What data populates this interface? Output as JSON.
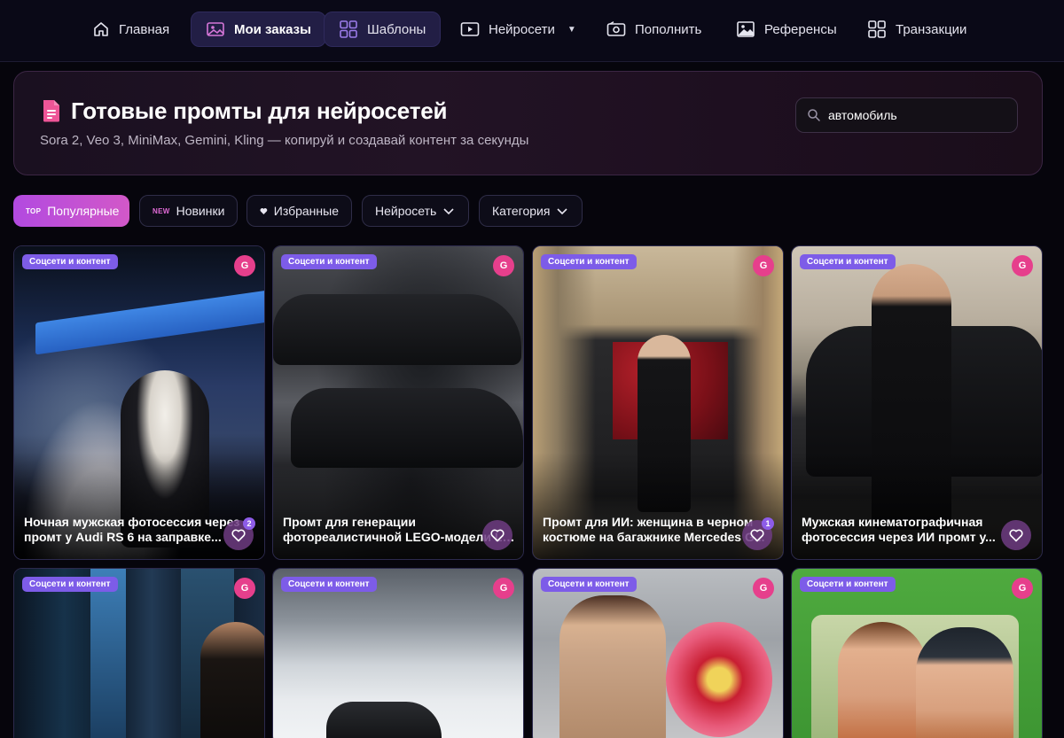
{
  "nav": {
    "items": [
      {
        "label": "Главная",
        "icon": "home-icon"
      },
      {
        "label": "Мои заказы",
        "icon": "image-icon"
      },
      {
        "label": "Шаблоны",
        "icon": "grid-icon"
      },
      {
        "label": "Нейросети",
        "icon": "play-icon"
      },
      {
        "label": "Пополнить",
        "icon": "wallet-icon"
      },
      {
        "label": "Референсы",
        "icon": "picture-icon"
      },
      {
        "label": "Транзакции",
        "icon": "grid-icon"
      }
    ]
  },
  "hero": {
    "title": "Готовые промты для нейросетей",
    "subtitle": "Sora 2, Veo 3, MiniMax, Gemini, Kling — копируй и создавай контент за секунды",
    "search_value": "автомобиль"
  },
  "filters": {
    "popular_tag": "TOP",
    "popular": "Популярные",
    "new_tag": "NEW",
    "new": "Новинки",
    "favorites": "Избранные",
    "network": "Нейросеть",
    "category": "Категория"
  },
  "cards": [
    {
      "badge": "Соцсети и контент",
      "model": "G",
      "line1": "Ночная мужская фотосессия через ИИ",
      "line2": "промт у Audi RS 6 на заправке...",
      "likes": "2"
    },
    {
      "badge": "Соцсети и контент",
      "model": "G",
      "line1": "Промт для генерации",
      "line2": "фотореалистичной LEGO-модели LADA",
      "likes": ""
    },
    {
      "badge": "Соцсети и контент",
      "model": "G",
      "line1": "Промт для ИИ: женщина в черном",
      "line2": "костюме на багажнике Mercedes G...",
      "likes": "1"
    },
    {
      "badge": "Соцсети и контент",
      "model": "G",
      "line1": "Мужская кинематографичная",
      "line2": "фотосессия через ИИ промт у...",
      "likes": ""
    },
    {
      "badge": "Соцсети и контент",
      "model": "G"
    },
    {
      "badge": "Соцсети и контент",
      "model": "G"
    },
    {
      "badge": "Соцсети и контент",
      "model": "G"
    },
    {
      "badge": "Соцсети и контент",
      "model": "G"
    }
  ],
  "colors": {
    "accent": "#7d5ce8",
    "model_dot": "#e63f8c",
    "primary_filter": "#c050d8"
  }
}
